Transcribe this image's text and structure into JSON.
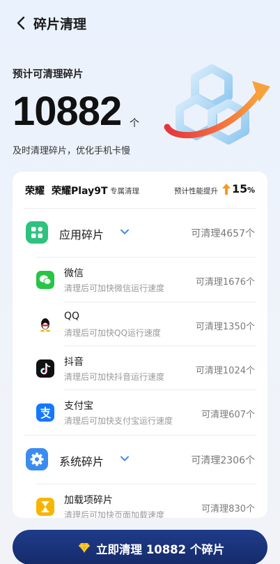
{
  "header": {
    "title": "碎片清理"
  },
  "summary": {
    "subtitle": "预计可清理碎片",
    "count": "10882",
    "unit": "个",
    "description": "及时清理碎片，优化手机卡慢"
  },
  "card": {
    "brand": "荣耀",
    "model": "荣耀Play9T",
    "exclusive": "专属清理",
    "perf_label": "预计性能提升",
    "perf_value": "15",
    "perf_unit": "%"
  },
  "groups": [
    {
      "label": "应用碎片",
      "count": "可清理4657个",
      "icon": "grid-icon",
      "color": "#2ec27e"
    },
    {
      "label": "系统碎片",
      "count": "可清理2306个",
      "icon": "gear-icon",
      "color": "#3b8cf0"
    }
  ],
  "app_items": [
    {
      "name": "微信",
      "hint": "清理后可加快微信运行速度",
      "count": "可清理1676个",
      "icon": "wechat-icon"
    },
    {
      "name": "QQ",
      "hint": "清理后可加快QQ运行速度",
      "count": "可清理1350个",
      "icon": "qq-icon"
    },
    {
      "name": "抖音",
      "hint": "清理后可加快抖音运行速度",
      "count": "可清理1024个",
      "icon": "douyin-icon"
    },
    {
      "name": "支付宝",
      "hint": "清理后可加快支付宝运行速度",
      "count": "可清理607个",
      "icon": "alipay-icon"
    }
  ],
  "system_items": [
    {
      "name": "加载项碎片",
      "hint": "清理后可加快页面加载速度",
      "count": "可清理830个",
      "icon": "hourglass-icon"
    }
  ],
  "cta": {
    "label": "立即清理 10882 个碎片"
  },
  "colors": {
    "accent": "#1f3b8a",
    "green": "#2ec27e",
    "blue": "#3b8cf0",
    "orange": "#f59a23"
  }
}
